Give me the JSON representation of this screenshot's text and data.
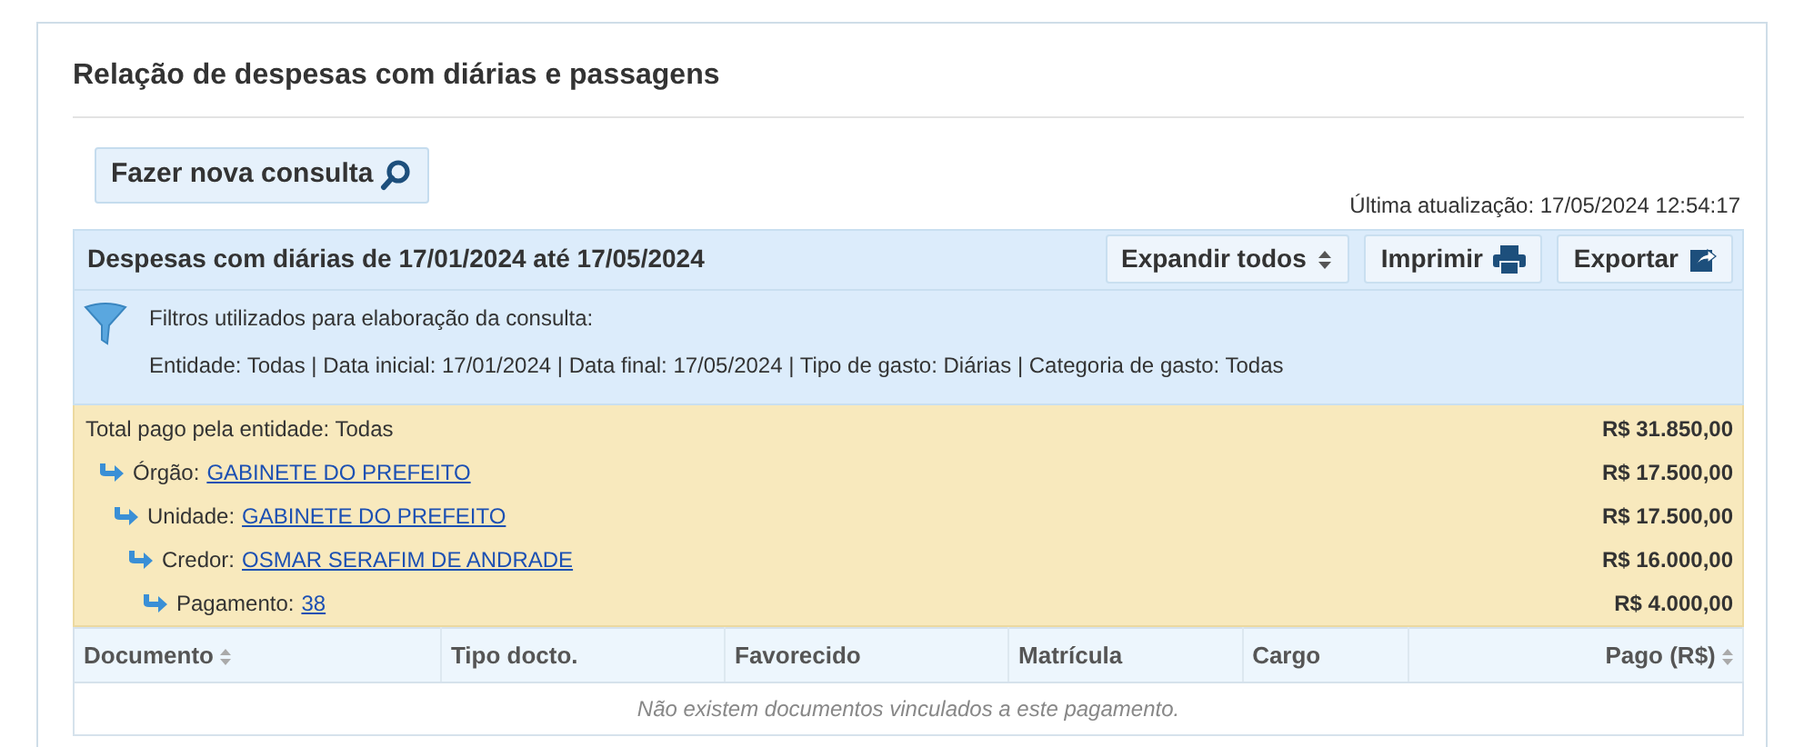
{
  "title": "Relação de despesas com diárias e passagens",
  "new_query_button": "Fazer nova consulta",
  "last_update": "Última atualização: 17/05/2024 12:54:17",
  "panel": {
    "heading": "Despesas com diárias de 17/01/2024 até 17/05/2024",
    "buttons": [
      {
        "label": "Expandir todos",
        "kind": "expand"
      },
      {
        "label": "Imprimir",
        "kind": "print"
      },
      {
        "label": "Exportar",
        "kind": "export"
      }
    ],
    "filters_title": "Filtros utilizados para elaboração da consulta:",
    "filters": "Entidade: Todas | Data inicial: 17/01/2024 | Data final: 17/05/2024 | Tipo de gasto: Diárias | Categoria de gasto: Todas"
  },
  "summary": {
    "label": "Total pago pela entidade: Todas",
    "value": "R$ 31.850,00",
    "children": [
      {
        "label": "Órgão:",
        "link": "GABINETE DO PREFEITO",
        "value": "R$ 17.500,00",
        "children": [
          {
            "label": "Unidade:",
            "link": "GABINETE DO PREFEITO",
            "value": "R$ 17.500,00",
            "children": [
              {
                "label": "Credor:",
                "link": "OSMAR SERAFIM DE ANDRADE",
                "value": "R$ 16.000,00",
                "children": [
                  {
                    "label": "Pagamento:",
                    "link": "38",
                    "value": "R$ 4.000,00"
                  }
                ]
              }
            ]
          }
        ]
      }
    ]
  },
  "table": {
    "columns": [
      {
        "label": "Documento",
        "sortable": true
      },
      {
        "label": "Tipo docto.",
        "sortable": false
      },
      {
        "label": "Favorecido",
        "sortable": false
      },
      {
        "label": "Matrícula",
        "sortable": false
      },
      {
        "label": "Cargo",
        "sortable": false
      },
      {
        "label": "Pago (R$)",
        "sortable": true
      }
    ],
    "empty_message": "Não existem documentos vinculados a este pagamento."
  }
}
